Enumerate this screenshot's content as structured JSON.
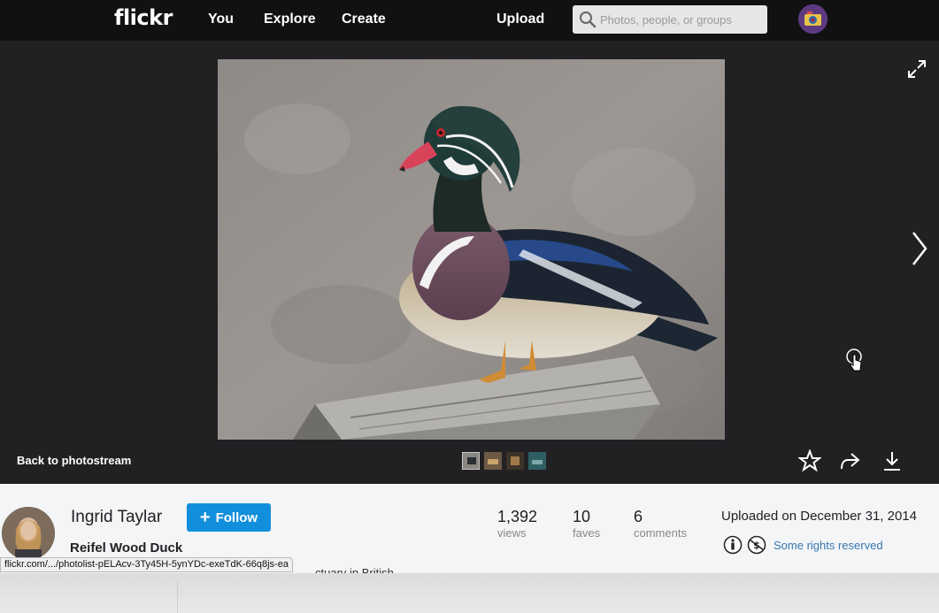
{
  "nav": {
    "logo": "flickr",
    "links": [
      "You",
      "Explore",
      "Create"
    ],
    "upload": "Upload",
    "search_placeholder": "Photos, people, or groups"
  },
  "photo": {
    "back_link": "Back to photostream",
    "thumbnail_count": 4
  },
  "owner": {
    "name": "Ingrid Taylar",
    "follow_label": "Follow"
  },
  "title": "Reifel Wood Duck",
  "stats": [
    {
      "value": "1,392",
      "label": "views"
    },
    {
      "value": "10",
      "label": "faves"
    },
    {
      "value": "6",
      "label": "comments"
    }
  ],
  "uploaded": "Uploaded on December 31, 2014",
  "rights": "Some rights reserved",
  "status_url": "flickr.com/.../photolist-pELAcv-3Ty45H-5ynYDc-exeTdK-66q8js-ea",
  "description_peek": "ctuary in British",
  "colors": {
    "follow": "#128fdc",
    "link": "#3777b3",
    "nav_bg": "#111112",
    "stage_bg": "#212124"
  }
}
